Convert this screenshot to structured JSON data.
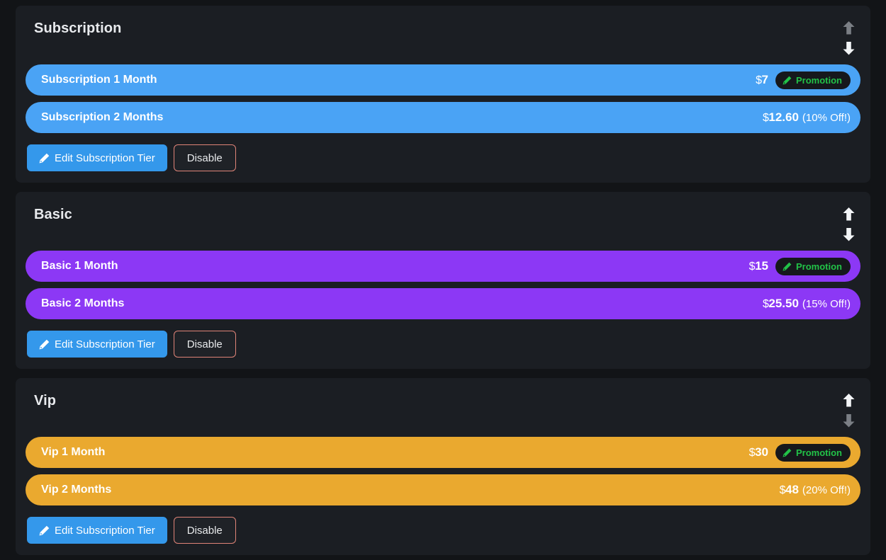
{
  "theme": {
    "page_bg": "#121417",
    "card_bg": "#1b1e23",
    "promo_badge_bg": "#16181c",
    "promo_text": "#22c348",
    "edit_button_bg": "#3498eb",
    "disable_button_border": "#e08478",
    "title_color": "#e8eaed",
    "arrow_enabled": "#f3f5f7",
    "arrow_disabled": "#7b7f85"
  },
  "icons": {
    "pencil": "pencil-icon",
    "arrow_up": "arrow-up-icon",
    "arrow_down": "arrow-down-icon"
  },
  "tiers": [
    {
      "title": "Subscription",
      "color": "#4aa3f5",
      "move_up": {
        "label": "Move Up",
        "enabled": false
      },
      "move_down": {
        "label": "Move Down",
        "enabled": true
      },
      "plans": [
        {
          "name": "Subscription 1 Month",
          "currency": "$",
          "price": "7",
          "discount": "",
          "promotion": {
            "label": "Promotion",
            "visible": true
          }
        },
        {
          "name": "Subscription 2 Months",
          "currency": "$",
          "price": "12.60",
          "discount": "(10% Off!)",
          "promotion": {
            "label": "Promotion",
            "visible": false
          }
        }
      ],
      "edit_label": "Edit Subscription Tier",
      "disable_label": "Disable"
    },
    {
      "title": "Basic",
      "color": "#8c38f5",
      "move_up": {
        "label": "Move Up",
        "enabled": true
      },
      "move_down": {
        "label": "Move Down",
        "enabled": true
      },
      "plans": [
        {
          "name": "Basic 1 Month",
          "currency": "$",
          "price": "15",
          "discount": "",
          "promotion": {
            "label": "Promotion",
            "visible": true
          }
        },
        {
          "name": "Basic 2 Months",
          "currency": "$",
          "price": "25.50",
          "discount": "(15% Off!)",
          "promotion": {
            "label": "Promotion",
            "visible": false
          }
        }
      ],
      "edit_label": "Edit Subscription Tier",
      "disable_label": "Disable"
    },
    {
      "title": "Vip",
      "color": "#eaa92f",
      "move_up": {
        "label": "Move Up",
        "enabled": true
      },
      "move_down": {
        "label": "Move Down",
        "enabled": false
      },
      "plans": [
        {
          "name": "Vip 1 Month",
          "currency": "$",
          "price": "30",
          "discount": "",
          "promotion": {
            "label": "Promotion",
            "visible": true
          }
        },
        {
          "name": "Vip 2 Months",
          "currency": "$",
          "price": "48",
          "discount": "(20% Off!)",
          "promotion": {
            "label": "Promotion",
            "visible": false
          }
        }
      ],
      "edit_label": "Edit Subscription Tier",
      "disable_label": "Disable"
    }
  ]
}
